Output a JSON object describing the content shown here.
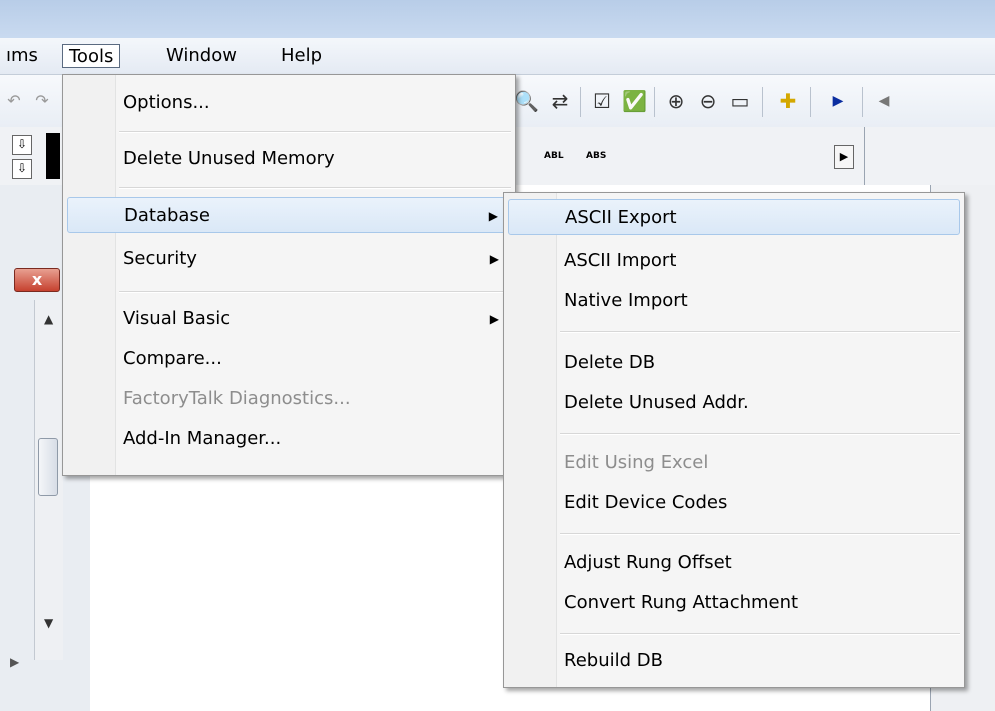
{
  "menubar": {
    "items": [
      {
        "label": "ıms"
      },
      {
        "label": "Tools"
      },
      {
        "label": "Window"
      },
      {
        "label": "Help"
      }
    ]
  },
  "toolbar2": {
    "abl": "ABL",
    "abs": "ABS"
  },
  "tools_menu": {
    "options": "Options...",
    "delete_unused_memory": "Delete Unused Memory",
    "database": "Database",
    "security": "Security",
    "visual_basic": "Visual Basic",
    "compare": "Compare...",
    "factorytalk_diagnostics": "FactoryTalk Diagnostics...",
    "add_in_manager": "Add-In Manager..."
  },
  "database_menu": {
    "ascii_export": "ASCII Export",
    "ascii_import": "ASCII Import",
    "native_import": "Native Import",
    "delete_db": "Delete DB",
    "delete_unused_addr": "Delete Unused Addr.",
    "edit_using_excel": "Edit Using Excel",
    "edit_device_codes": "Edit Device Codes",
    "adjust_rung_offset": "Adjust Rung Offset",
    "convert_rung_attachment": "Convert Rung Attachment",
    "rebuild_db": "Rebuild DB"
  },
  "icons": {
    "submenu_arrow": "▶",
    "close": "x"
  }
}
